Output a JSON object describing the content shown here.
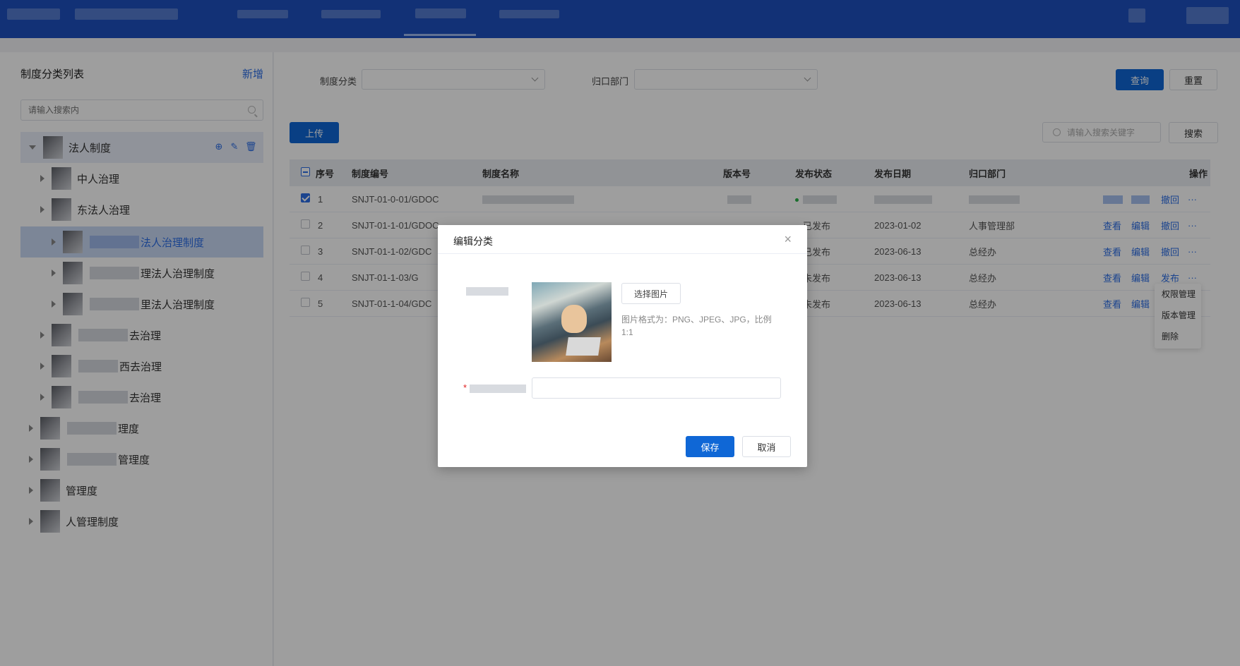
{
  "left": {
    "title": "制度分类列表",
    "add_label": "新增",
    "search_placeholder": "请输入搜索内",
    "tree": [
      {
        "label": "法人制度",
        "level": 0,
        "expanded": true
      },
      {
        "label": "中人治理",
        "level": 1
      },
      {
        "label": "东法人治理",
        "level": 1
      },
      {
        "label": "法人治理制度",
        "level": 2,
        "selected": true
      },
      {
        "label": "理法人治理制度",
        "level": 2
      },
      {
        "label": "里法人治理制度",
        "level": 2
      },
      {
        "label": "去治理",
        "level": 1
      },
      {
        "label": "西去治理",
        "level": 1
      },
      {
        "label": "去治理",
        "level": 1
      },
      {
        "label": "理度",
        "level": 0
      },
      {
        "label": "管理度",
        "level": 0
      },
      {
        "label": "管理度",
        "level": 0
      },
      {
        "label": "人管理制度",
        "level": 0
      }
    ]
  },
  "filters": {
    "category_label": "制度分类",
    "dept_label": "归口部门",
    "query_label": "查询",
    "reset_label": "重置"
  },
  "toolbar": {
    "upload_label": "上传",
    "search_placeholder": "请输入搜索关键字",
    "search_label": "搜索"
  },
  "table": {
    "headers": [
      "序号",
      "制度编号",
      "制度名称",
      "版本号",
      "发布状态",
      "发布日期",
      "归口部门",
      "操作"
    ],
    "rows": [
      {
        "no": "1",
        "code": "SNJT-01-0-01/GDOC",
        "name": "",
        "version": "",
        "status": "",
        "date": "",
        "dept": "",
        "ops": [
          "",
          "",
          "撤回",
          "···"
        ],
        "checked": true
      },
      {
        "no": "2",
        "code": "SNJT-01-1-01/GDOC",
        "name": "",
        "version": "",
        "status": "已发布",
        "date": "2023-01-02",
        "dept": "人事管理部",
        "ops": [
          "查看",
          "编辑",
          "撤回",
          "···"
        ]
      },
      {
        "no": "3",
        "code": "SNJT-01-1-02/GDC",
        "name": "",
        "version": "",
        "status": "已发布",
        "date": "2023-06-13",
        "dept": "总经办",
        "ops": [
          "查看",
          "编辑",
          "撤回",
          "···"
        ]
      },
      {
        "no": "4",
        "code": "SNJT-01-1-03/G",
        "name": "",
        "version": "",
        "status": "未发布",
        "date": "2023-06-13",
        "dept": "总经办",
        "ops": [
          "查看",
          "编辑",
          "发布",
          "···"
        ]
      },
      {
        "no": "5",
        "code": "SNJT-01-1-04/GDC",
        "name": "",
        "version": "",
        "status": "未发布",
        "date": "2023-06-13",
        "dept": "总经办",
        "ops": [
          "查看",
          "编辑",
          "",
          ""
        ]
      }
    ]
  },
  "dropdown_menu": [
    "权限管理",
    "版本管理",
    "删除"
  ],
  "modal": {
    "title": "编辑分类",
    "pick_label": "选择图片",
    "tip": "图片格式为：PNG、JPEG、JPG，比例1:1",
    "save_label": "保存",
    "cancel_label": "取消"
  },
  "colors": {
    "primary": "#0f67d6",
    "topbar": "#1d4fbf",
    "link": "#2d6ee6"
  }
}
